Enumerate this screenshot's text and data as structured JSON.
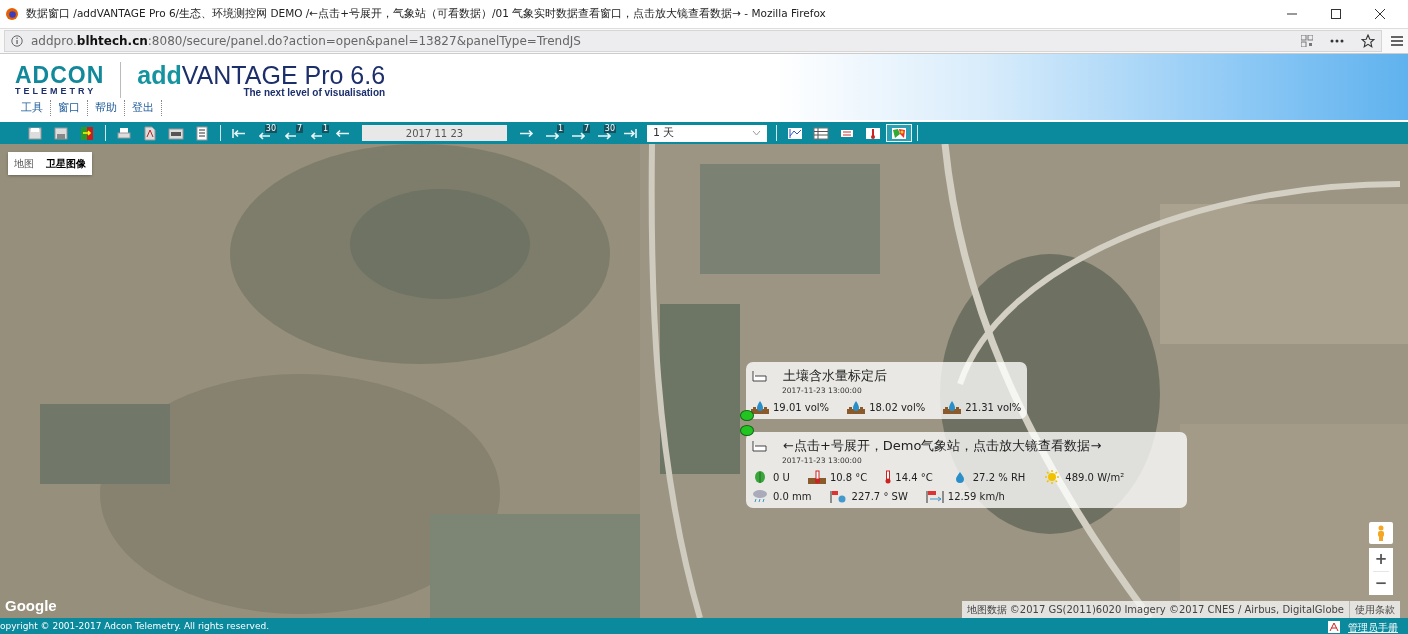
{
  "window": {
    "title": "数据窗口 /addVANTAGE Pro 6/生态、环境测控网 DEMO /←点击+号展开，气象站（可看数据）/01 气象实时数据查看窗口，点击放大镜查看数据→ - Mozilla Firefox"
  },
  "address_bar": {
    "url": "addpro.**blhtech.cn**:8080/secure/panel.do?action=open&panel=13827&panelType=TrendJS"
  },
  "header": {
    "logo_top": "ADCON",
    "logo_bottom": "TELEMETRY",
    "app_name_prefix": "add",
    "app_name": "VANTAGE Pro 6.6",
    "tagline": "The next level of visualisation"
  },
  "menu": [
    "工具",
    "窗口",
    "帮助",
    "登出"
  ],
  "toolbar": [
    {
      "kind": "button"
    },
    {
      "kind": "button"
    },
    {
      "kind": "button"
    },
    {
      "kind": "separator"
    },
    {
      "kind": "button"
    },
    {
      "kind": "button"
    },
    {
      "kind": "button"
    },
    {
      "kind": "button"
    },
    {
      "kind": "separator"
    },
    {
      "kind": "button"
    },
    {
      "kind": "button",
      "label": "30"
    },
    {
      "kind": "button",
      "label": "7"
    },
    {
      "kind": "button",
      "label": "1"
    },
    {
      "kind": "button"
    },
    {
      "kind": "date",
      "value": "2017 11 23"
    },
    {
      "kind": "button"
    },
    {
      "kind": "button",
      "label": "1"
    },
    {
      "kind": "button",
      "label": "7"
    },
    {
      "kind": "button",
      "label": "30"
    },
    {
      "kind": "button"
    },
    {
      "kind": "select",
      "value": "1 天"
    },
    {
      "kind": "separator"
    },
    {
      "kind": "button",
      "selected": false
    },
    {
      "kind": "button",
      "selected": false
    },
    {
      "kind": "button",
      "selected": false
    },
    {
      "kind": "button",
      "selected": false
    },
    {
      "kind": "button",
      "selected": true
    },
    {
      "kind": "separator"
    }
  ],
  "map": {
    "map_types": [
      {
        "label": "地图",
        "selected": false
      },
      {
        "label": "卫星图像",
        "selected": true
      }
    ],
    "popups": [
      {
        "title": "土壤含水量标定后",
        "time": "2017-11-23 13:00:00",
        "readings": [
          {
            "kind": "soil_moisture",
            "value": "19.01 vol%"
          },
          {
            "kind": "soil_moisture",
            "value": "18.02 vol%"
          },
          {
            "kind": "soil_moisture",
            "value": "21.31 vol%"
          }
        ]
      },
      {
        "title": "←点击+号展开，Demo气象站，点击放大镜查看数据→",
        "time": "2017-11-23 13:00:00",
        "readings": [
          {
            "kind": "leaf",
            "value": "0 U"
          },
          {
            "kind": "soil_temp",
            "value": "10.8 °C"
          },
          {
            "kind": "air_temp",
            "value": "14.4 °C"
          },
          {
            "kind": "humidity",
            "value": "27.2 % RH"
          },
          {
            "kind": "radiation",
            "value": "489.0 W/m²"
          },
          {
            "kind": "rain",
            "value": "0.0 mm"
          },
          {
            "kind": "wind_dir",
            "value": "227.7 ° SW"
          },
          {
            "kind": "wind_speed",
            "value": "12.59 km/h"
          }
        ]
      }
    ],
    "markers": [
      {
        "color": "#22c422"
      },
      {
        "color": "#22c422"
      }
    ],
    "logo": "Google",
    "attribution": "地图数据 ©2017 GS(2011)6020 Imagery ©2017 CNES / Airbus, DigitalGlobe",
    "terms": "使用条款",
    "zoom_in": "+",
    "zoom_out": "−"
  },
  "footer": {
    "copyright": "opyright © 2001-2017 Adcon Telemetry. All rights reserved.",
    "manual": "管理员手册"
  }
}
